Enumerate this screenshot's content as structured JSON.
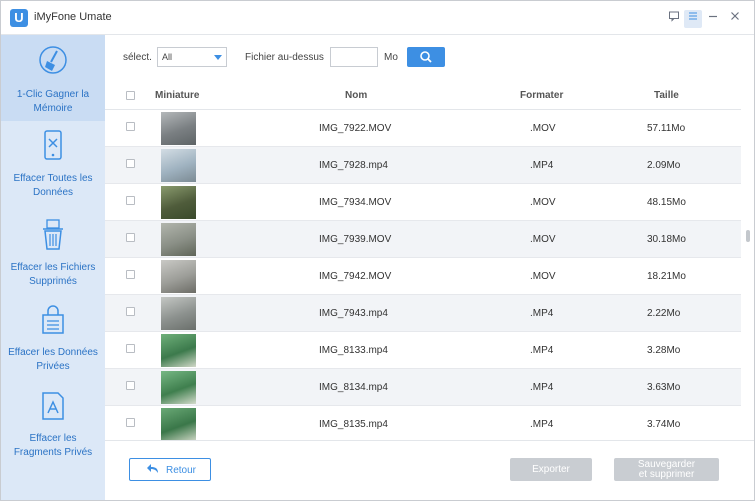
{
  "app": {
    "title": "iMyFone Umate",
    "logo_letter": "U"
  },
  "window_controls": [
    "feedback-icon",
    "menu-icon",
    "minimize-icon",
    "close-icon"
  ],
  "sidebar": {
    "items": [
      {
        "label": "1-Clic Gagner la Mémoire",
        "icon": "broom-icon",
        "active": true
      },
      {
        "label": "Effacer Toutes les Données",
        "icon": "phone-erase-icon",
        "active": false
      },
      {
        "label": "Effacer les Fichiers Supprimés",
        "icon": "trash-files-icon",
        "active": false
      },
      {
        "label": "Effacer les Données Privées",
        "icon": "lock-data-icon",
        "active": false
      },
      {
        "label": "Effacer les Fragments Privés",
        "icon": "app-fragments-icon",
        "active": false
      }
    ]
  },
  "filter": {
    "select_label": "sélect.",
    "select_value": "All",
    "size_label": "Fichier au-dessus",
    "size_value": "",
    "size_unit": "Mo",
    "search_icon": "search-icon"
  },
  "table": {
    "headers": {
      "miniature": "Miniature",
      "nom": "Nom",
      "formater": "Formater",
      "taille": "Taille"
    },
    "rows": [
      {
        "name": "IMG_7922.MOV",
        "format": ".MOV",
        "size": "57.11Mo"
      },
      {
        "name": "IMG_7928.mp4",
        "format": ".MP4",
        "size": "2.09Mo"
      },
      {
        "name": "IMG_7934.MOV",
        "format": ".MOV",
        "size": "48.15Mo"
      },
      {
        "name": "IMG_7939.MOV",
        "format": ".MOV",
        "size": "30.18Mo"
      },
      {
        "name": "IMG_7942.MOV",
        "format": ".MOV",
        "size": "18.21Mo"
      },
      {
        "name": "IMG_7943.mp4",
        "format": ".MP4",
        "size": "2.22Mo"
      },
      {
        "name": "IMG_8133.mp4",
        "format": ".MP4",
        "size": "3.28Mo"
      },
      {
        "name": "IMG_8134.mp4",
        "format": ".MP4",
        "size": "3.63Mo"
      },
      {
        "name": "IMG_8135.mp4",
        "format": ".MP4",
        "size": "3.74Mo"
      }
    ]
  },
  "footer": {
    "back_label": "Retour",
    "export_label": "Exporter",
    "save_label_line1": "Sauvegarder",
    "save_label_line2": "et supprimer"
  },
  "colors": {
    "accent": "#3d8fe3",
    "sidebar_bg": "#dce8f7",
    "sidebar_active": "#c9dcf3",
    "disabled_button": "#c9cdd2"
  }
}
